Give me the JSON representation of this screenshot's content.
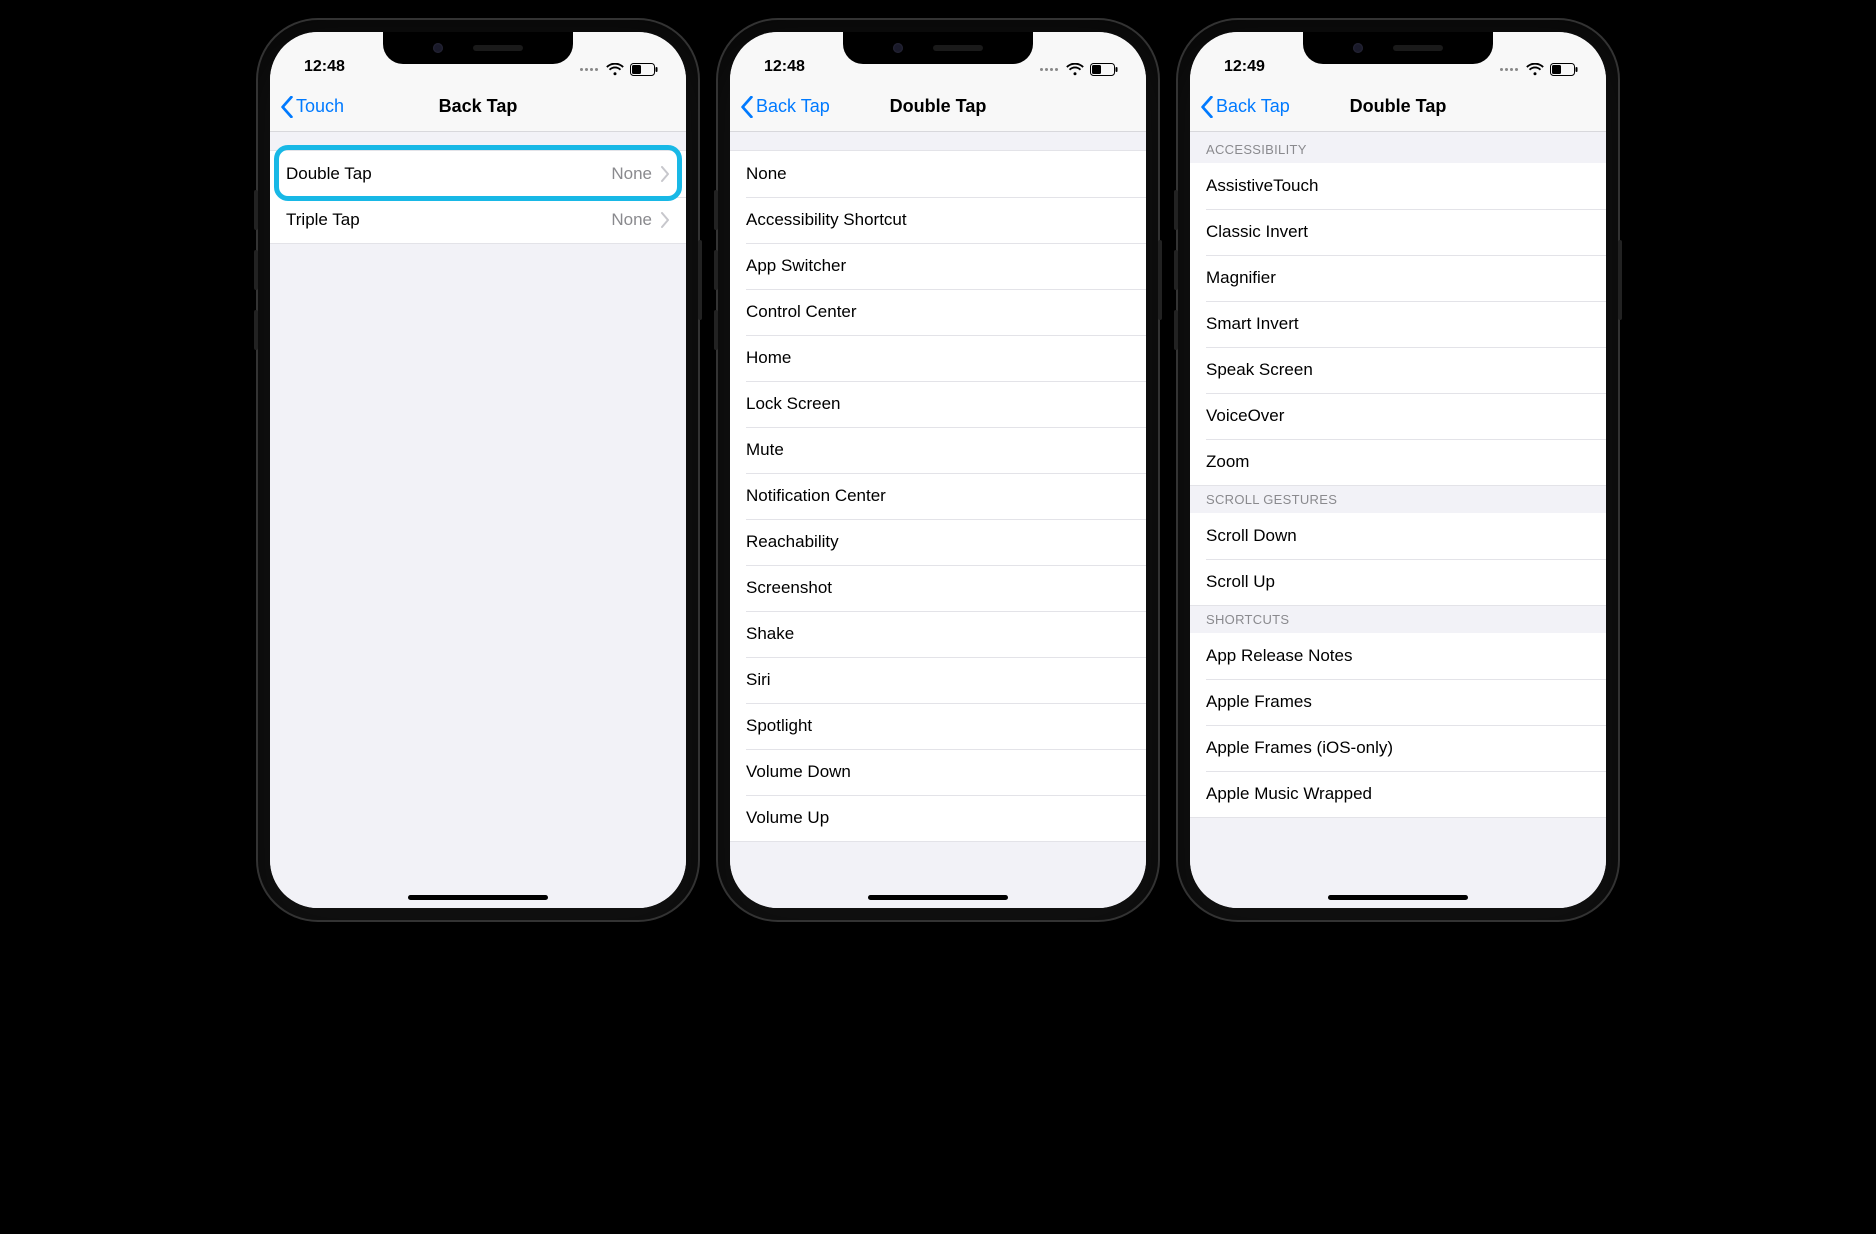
{
  "phone1": {
    "time": "12:48",
    "back_label": "Touch",
    "title": "Back Tap",
    "rows": [
      {
        "label": "Double Tap",
        "value": "None"
      },
      {
        "label": "Triple Tap",
        "value": "None"
      }
    ]
  },
  "phone2": {
    "time": "12:48",
    "back_label": "Back Tap",
    "title": "Double Tap",
    "options": [
      "None",
      "Accessibility Shortcut",
      "App Switcher",
      "Control Center",
      "Home",
      "Lock Screen",
      "Mute",
      "Notification Center",
      "Reachability",
      "Screenshot",
      "Shake",
      "Siri",
      "Spotlight",
      "Volume Down",
      "Volume Up"
    ]
  },
  "phone3": {
    "time": "12:49",
    "back_label": "Back Tap",
    "title": "Double Tap",
    "sections": [
      {
        "header": "Accessibility",
        "items": [
          "AssistiveTouch",
          "Classic Invert",
          "Magnifier",
          "Smart Invert",
          "Speak Screen",
          "VoiceOver",
          "Zoom"
        ]
      },
      {
        "header": "Scroll Gestures",
        "items": [
          "Scroll Down",
          "Scroll Up"
        ]
      },
      {
        "header": "Shortcuts",
        "items": [
          "App Release Notes",
          "Apple Frames",
          "Apple Frames (iOS-only)",
          "Apple Music Wrapped"
        ]
      }
    ]
  }
}
